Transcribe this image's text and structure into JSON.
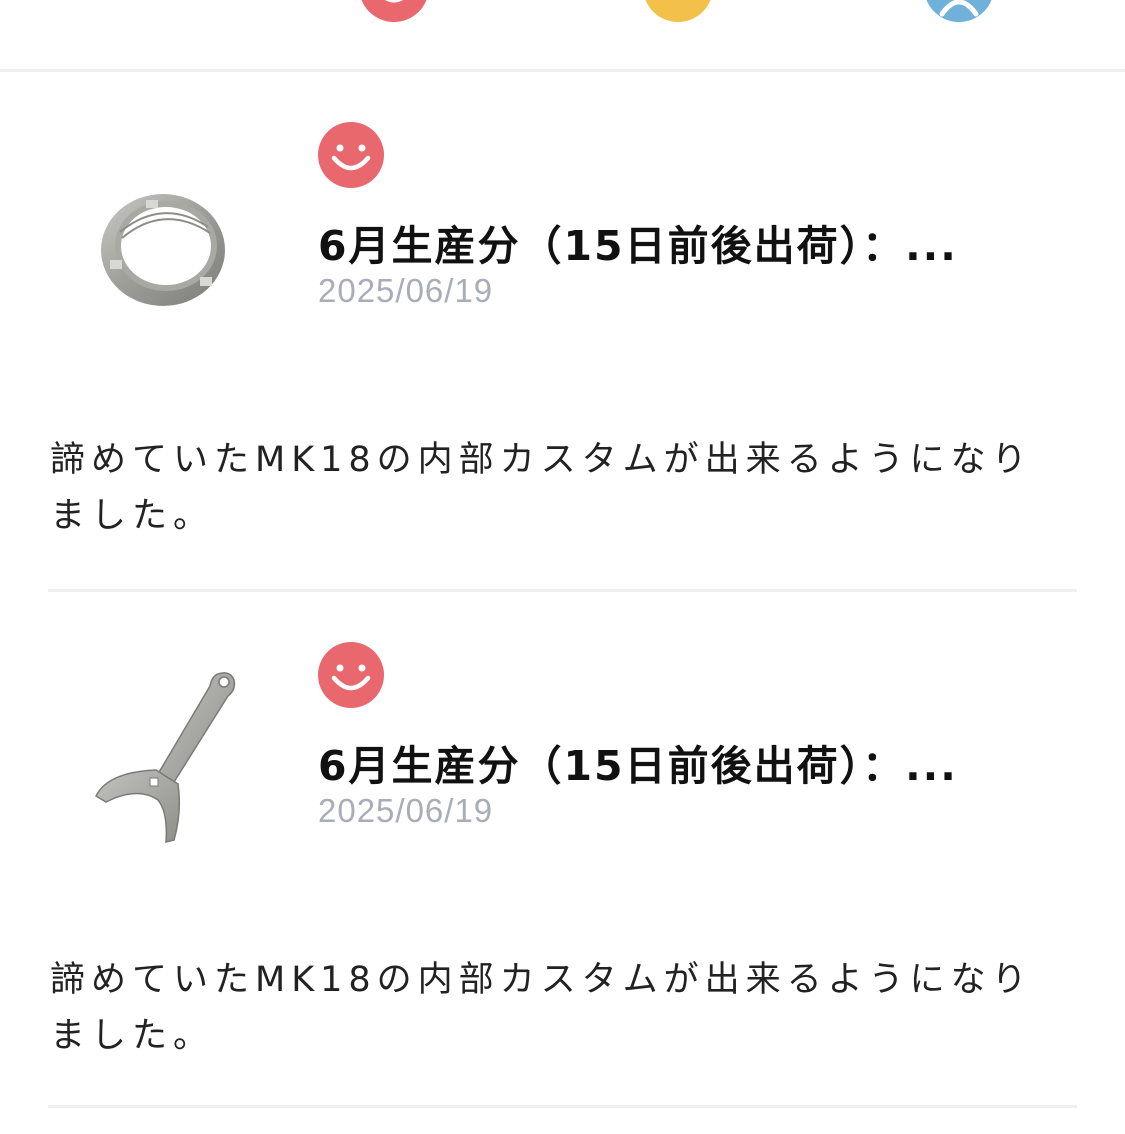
{
  "rating_filter": {
    "options": [
      {
        "icon": "smile-face-icon",
        "color": "#e8686d"
      },
      {
        "icon": "neutral-face-icon",
        "color": "#f3c14a"
      },
      {
        "icon": "frown-face-icon",
        "color": "#6fb1d8"
      }
    ]
  },
  "reviews": [
    {
      "rating_icon": "smile-face-icon",
      "product_icon": "ring-nut-icon",
      "title": "6月生産分（15日前後出荷）：...",
      "date": "2025/06/19",
      "text": "諦めていたMK18の内部カスタムが出来るようになりました。"
    },
    {
      "rating_icon": "smile-face-icon",
      "product_icon": "wrench-icon",
      "title": "6月生産分（15日前後出荷）：...",
      "date": "2025/06/19",
      "text": "諦めていたMK18の内部カスタムが出来るようになりました。"
    }
  ],
  "colors": {
    "smile": "#e8686d",
    "date": "#a8adb8",
    "divider": "#efefef"
  }
}
